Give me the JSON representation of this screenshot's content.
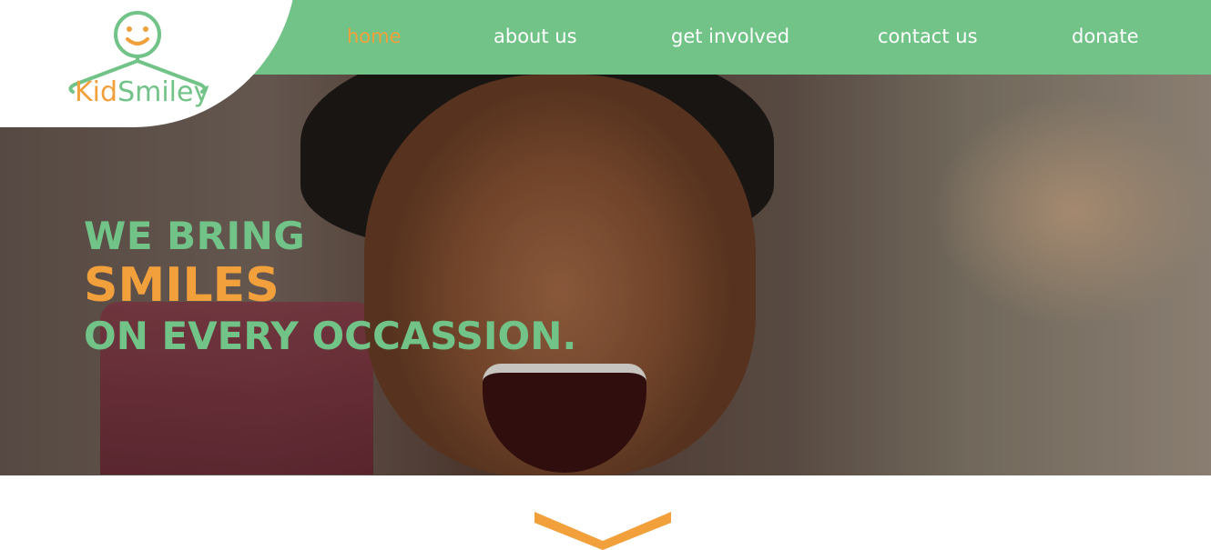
{
  "brand": {
    "kid": "Kid",
    "smiley": "Smiley"
  },
  "nav": {
    "items": [
      {
        "label": "home",
        "active": true
      },
      {
        "label": "about us"
      },
      {
        "label": "get involved"
      },
      {
        "label": "contact us"
      },
      {
        "label": "donate"
      }
    ]
  },
  "hero": {
    "line1": "WE BRING",
    "line2": "SMILES",
    "line3": "ON EVERY OCCASSION."
  },
  "colors": {
    "green": "#71c387",
    "orange": "#f2a03c",
    "white": "#ffffff"
  },
  "icons": {
    "logo": "smiley-hanger-icon",
    "scroll": "chevron-down-icon"
  }
}
